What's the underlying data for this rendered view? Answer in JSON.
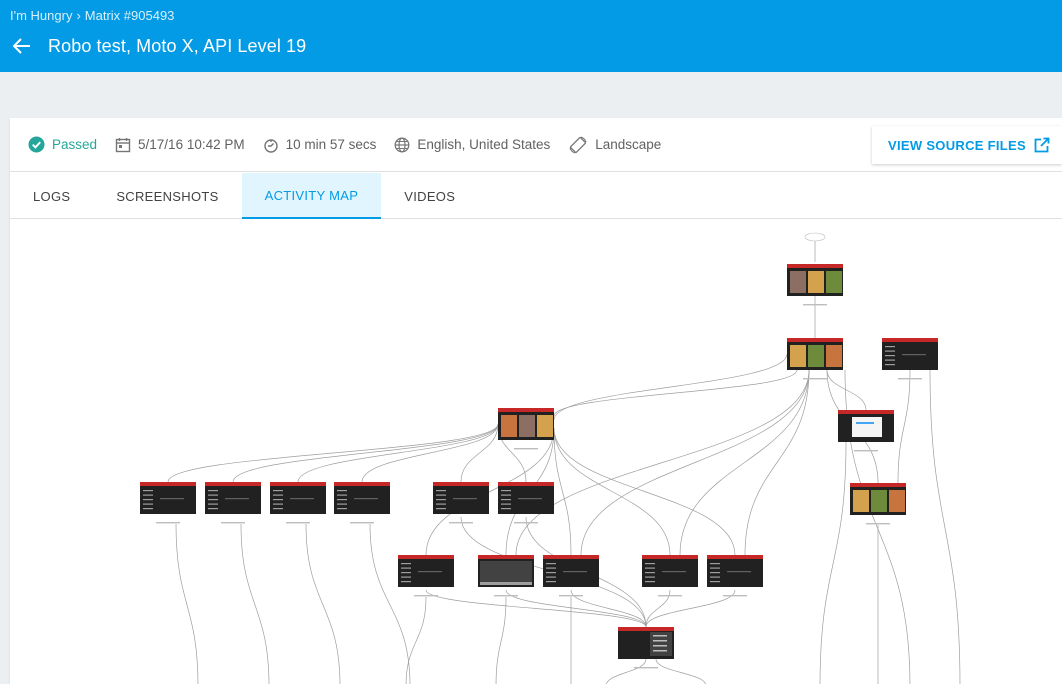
{
  "breadcrumb": {
    "app": "I'm Hungry",
    "separator": "›",
    "matrix": "Matrix #905493"
  },
  "title": "Robo test, Moto X, API Level 19",
  "info": {
    "status": "Passed",
    "date": "5/17/16 10:42 PM",
    "duration": "10 min 57 secs",
    "locale": "English, United States",
    "orientation": "Landscape"
  },
  "actions": {
    "view_source": "VIEW SOURCE FILES"
  },
  "tabs": [
    {
      "label": "LOGS",
      "active": false
    },
    {
      "label": "SCREENSHOTS",
      "active": false
    },
    {
      "label": "ACTIVITY MAP",
      "active": true
    },
    {
      "label": "VIDEOS",
      "active": false
    }
  ],
  "colors": {
    "app_bar": "#039be5",
    "passed": "#26a69a",
    "accent": "#039be5",
    "screen_red": "#c62828",
    "screen_dark": "#212121"
  }
}
